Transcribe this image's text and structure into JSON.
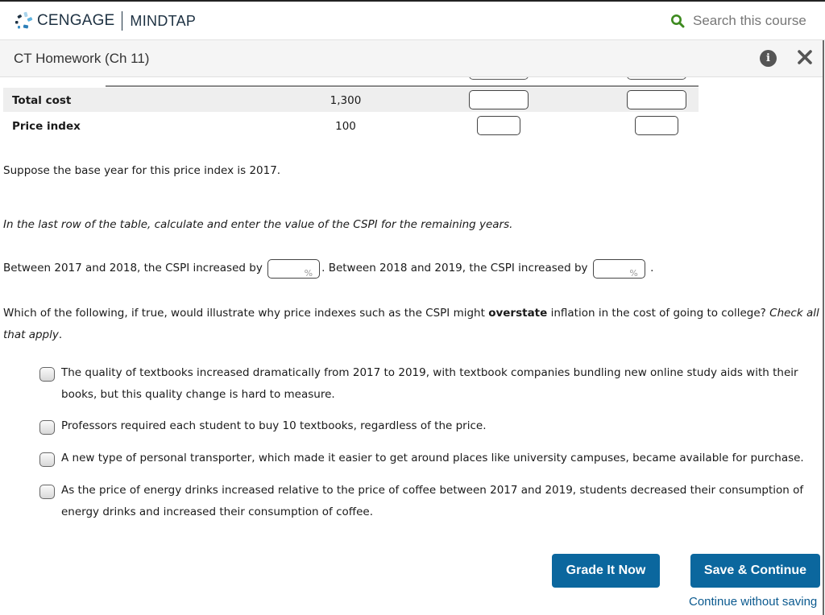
{
  "header": {
    "brand_primary": "CENGAGE",
    "brand_secondary": "MINDTAP",
    "search_placeholder": "Search this course",
    "icons": {
      "search": "search-icon",
      "logo": "cengage-logo-icon"
    },
    "colors": {
      "search_icon": "#3d8a1f",
      "brand_text": "#1d3142"
    }
  },
  "titlebar": {
    "title": "CT Homework (Ch 11)",
    "info_label": "i",
    "icons": {
      "info": "info-icon",
      "close": "close-icon"
    }
  },
  "table": {
    "rows": [
      {
        "label": "Total cost",
        "base_value": "1,300",
        "inputs": [
          "",
          ""
        ]
      },
      {
        "label": "Price index",
        "base_value": "100",
        "inputs": [
          "",
          ""
        ]
      }
    ]
  },
  "question": {
    "base_year_text": "Suppose the base year for this price index is 2017.",
    "instruction": "In the last row of the table, calculate and enter the value of the CSPI for the remaining years.",
    "increase_1_prefix": "Between 2017 and 2018, the CSPI increased by",
    "increase_2_prefix": ". Between 2018 and 2019, the CSPI increased by",
    "increase_suffix": ".",
    "percent_symbol": "%",
    "increase_1_value": "",
    "increase_2_value": "",
    "prompt_part1": "Which of the following, if true, would illustrate why price indexes such as the CSPI might ",
    "prompt_bold": "overstate",
    "prompt_part2": " inflation in the cost of going to college? ",
    "prompt_italic": "Check all that apply",
    "prompt_end": "."
  },
  "options": [
    {
      "text": "The quality of textbooks increased dramatically from 2017 to 2019, with textbook companies bundling new online study aids with their books, but this quality change is hard to measure.",
      "checked": false
    },
    {
      "text": "Professors required each student to buy 10 textbooks, regardless of the price.",
      "checked": false
    },
    {
      "text": "A new type of personal transporter, which made it easier to get around places like university campuses, became available for purchase.",
      "checked": false
    },
    {
      "text": "As the price of energy drinks increased relative to the price of coffee between 2017 and 2019, students decreased their consumption of energy drinks and increased their consumption of coffee.",
      "checked": false
    }
  ],
  "actions": {
    "grade_label": "Grade It Now",
    "save_label": "Save & Continue",
    "continue_label": "Continue without saving",
    "button_color": "#0b679e"
  }
}
